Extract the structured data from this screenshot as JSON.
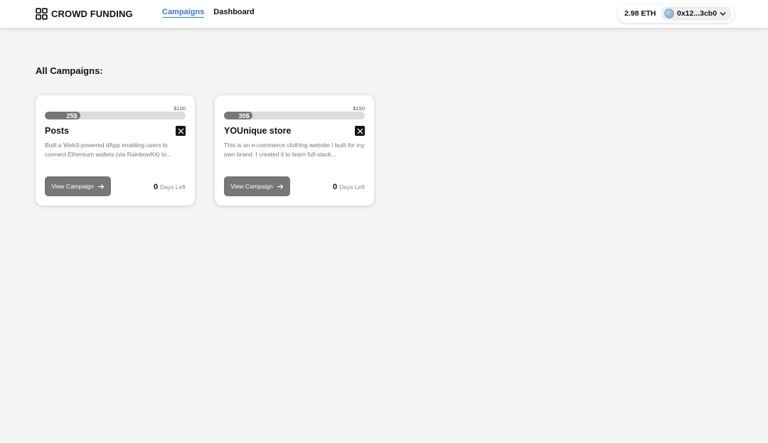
{
  "header": {
    "logo_text": "CROWD FUNDING",
    "logo_icon": "grid-icon",
    "nav": [
      {
        "label": "Campaigns",
        "active": true
      },
      {
        "label": "Dashboard",
        "active": false
      }
    ],
    "wallet": {
      "balance": "2.98 ETH",
      "address": "0x12...3cb0",
      "dropdown_icon": "chevron-down-icon"
    }
  },
  "main": {
    "section_title": "All Campaigns:",
    "campaigns": [
      {
        "title": "Posts",
        "target": "$100",
        "raised": "25$",
        "progress_percent": 25,
        "description": "Built a Web3-powered dApp enabling users to connect Ethereum wallets (via RainbowKit) to...",
        "button_label": "View Campaign",
        "days_left": "0",
        "days_label": "Days Left",
        "social_icon": "x-icon"
      },
      {
        "title": "YOUnique store",
        "target": "$150",
        "raised": "30$",
        "progress_percent": 20,
        "description": "This is an e-commerce clothing website I built for my own brand. I created it to learn full-stack...",
        "button_label": "View Campaign",
        "days_left": "0",
        "days_label": "Days Left",
        "social_icon": "x-icon"
      }
    ]
  },
  "colors": {
    "accent": "#3b78d8",
    "button": "#777777",
    "background": "#f4f4f4"
  }
}
